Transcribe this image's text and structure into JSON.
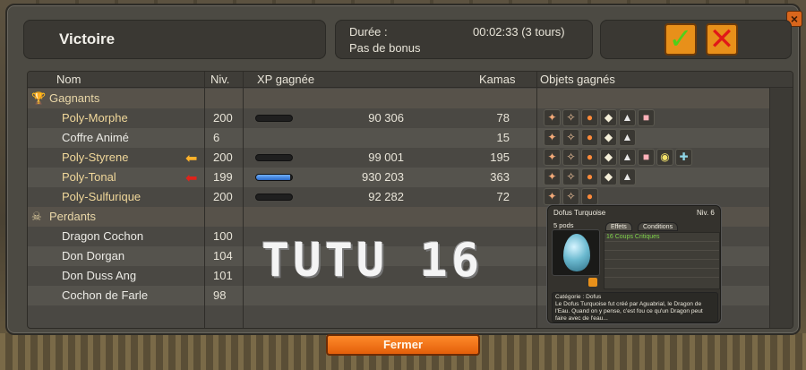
{
  "window": {
    "title": "Victoire",
    "close_glyph": "×"
  },
  "info": {
    "duration_label": "Durée :",
    "duration_value": "00:02:33 (3 tours)",
    "bonus_label": "Pas de bonus"
  },
  "actions": {
    "ok_glyph": "✓",
    "cancel_glyph": "✕"
  },
  "table": {
    "headers": {
      "name": "Nom",
      "level": "Niv.",
      "xp": "XP gagnée",
      "kamas": "Kamas",
      "items": "Objets gagnés"
    },
    "groups": {
      "winners": {
        "label": "Gagnants",
        "icon": "trophy-icon",
        "glyph": "🏆"
      },
      "losers": {
        "label": "Perdants",
        "icon": "skull-icon",
        "glyph": "☠"
      }
    },
    "winners": [
      {
        "name": "Poly-Morphe",
        "level": "200",
        "xp": "90 306",
        "xp_fill": 0,
        "kamas": "78",
        "items": 6,
        "arrow": ""
      },
      {
        "name": "Coffre Animé",
        "level": "6",
        "xp": "",
        "xp_fill": null,
        "kamas": "15",
        "items": 5,
        "arrow": ""
      },
      {
        "name": "Poly-Styrene",
        "level": "200",
        "xp": "99 001",
        "xp_fill": 0,
        "kamas": "195",
        "items": 8,
        "arrow": "yellow"
      },
      {
        "name": "Poly-Tonal",
        "level": "199",
        "xp": "930 203",
        "xp_fill": 0.95,
        "kamas": "363",
        "items": 5,
        "arrow": "red"
      },
      {
        "name": "Poly-Sulfurique",
        "level": "200",
        "xp": "92 282",
        "xp_fill": 0,
        "kamas": "72",
        "items": 3,
        "arrow": ""
      }
    ],
    "losers": [
      {
        "name": "Dragon Cochon",
        "level": "100"
      },
      {
        "name": "Don Dorgan",
        "level": "104"
      },
      {
        "name": "Don Duss Ang",
        "level": "101"
      },
      {
        "name": "Cochon de Farle",
        "level": "98"
      }
    ]
  },
  "watermark": "TUTU 16",
  "tooltip": {
    "title": "Dofus Turquoise",
    "level": "Niv. 6",
    "pods": "5 pods",
    "tab_effects": "Effets",
    "tab_conditions": "Conditions",
    "effect": "16 Coups Critiques",
    "category": "Catégorie : Dofus",
    "description": "Le Dofus Turquoise fut créé par Aguabrial, le Dragon de l'Eau. Quand on y pense, c'est fou ce qu'un Dragon peut faire avec de l'eau..."
  },
  "footer": {
    "close_label": "Fermer"
  },
  "colors": {
    "accent": "#e8901a",
    "winner_name": "#f0d79a",
    "xp_fill": "#2a6ac8"
  }
}
